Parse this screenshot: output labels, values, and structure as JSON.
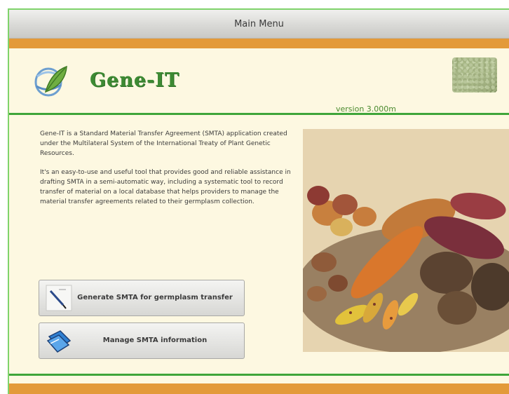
{
  "window": {
    "title": "Main Menu"
  },
  "header": {
    "app_name": "Gene-IT",
    "version": "version 3.000m"
  },
  "description": {
    "paragraph1": "Gene-IT is a Standard Material Transfer Agreement (SMTA) application created under the Multilateral System of the International Treaty of Plant Genetic Resources.",
    "paragraph2": "It's an easy-to-use and useful tool that provides good and reliable assistance in drafting SMTA in a semi-automatic way, including a systematic tool to record transfer of material on a local database that helps providers to manage the material transfer agreements related to their germplasm collection."
  },
  "buttons": {
    "generate": {
      "label": "Generate SMTA for germplasm transfer",
      "icon": "pen-icon"
    },
    "manage": {
      "label": "Manage SMTA information",
      "icon": "folders-icon"
    }
  },
  "colors": {
    "accent_orange": "#e39a3a",
    "accent_green": "#3fa53a",
    "background": "#fdf8e1",
    "logo_green": "#3d8a33"
  }
}
